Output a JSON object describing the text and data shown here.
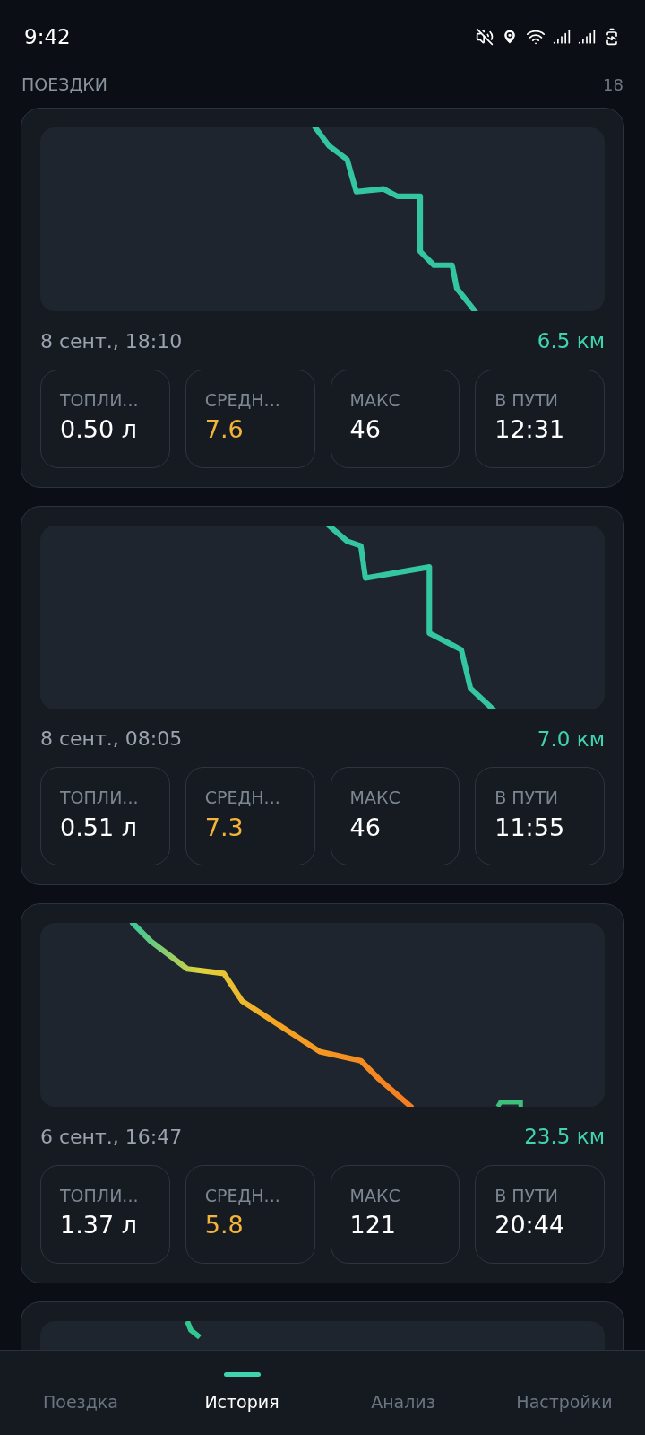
{
  "status_bar": {
    "time": "9:42"
  },
  "header": {
    "title": "ПОЕЗДКИ",
    "count": "18"
  },
  "trips": [
    {
      "date": "8 сент., 18:10",
      "distance": "6.5 км",
      "stats": [
        {
          "label": "ТОПЛИ...",
          "value": "0.50 л",
          "accent": false
        },
        {
          "label": "СРЕДН...",
          "value": "7.6",
          "accent": true
        },
        {
          "label": "МАКС",
          "value": "46",
          "accent": false
        },
        {
          "label": "В ПУТИ",
          "value": "12:31",
          "accent": false
        }
      ]
    },
    {
      "date": "8 сент., 08:05",
      "distance": "7.0 км",
      "stats": [
        {
          "label": "ТОПЛИ...",
          "value": "0.51 л",
          "accent": false
        },
        {
          "label": "СРЕДН...",
          "value": "7.3",
          "accent": true
        },
        {
          "label": "МАКС",
          "value": "46",
          "accent": false
        },
        {
          "label": "В ПУТИ",
          "value": "11:55",
          "accent": false
        }
      ]
    },
    {
      "date": "6 сент., 16:47",
      "distance": "23.5 км",
      "stats": [
        {
          "label": "ТОПЛИ...",
          "value": "1.37 л",
          "accent": false
        },
        {
          "label": "СРЕДН...",
          "value": "5.8",
          "accent": true
        },
        {
          "label": "МАКС",
          "value": "121",
          "accent": false
        },
        {
          "label": "В ПУТИ",
          "value": "20:44",
          "accent": false
        }
      ]
    }
  ],
  "nav": [
    {
      "label": "Поездка",
      "selected": false
    },
    {
      "label": "История",
      "selected": true
    },
    {
      "label": "Анализ",
      "selected": false
    },
    {
      "label": "Настройки",
      "selected": false
    }
  ]
}
